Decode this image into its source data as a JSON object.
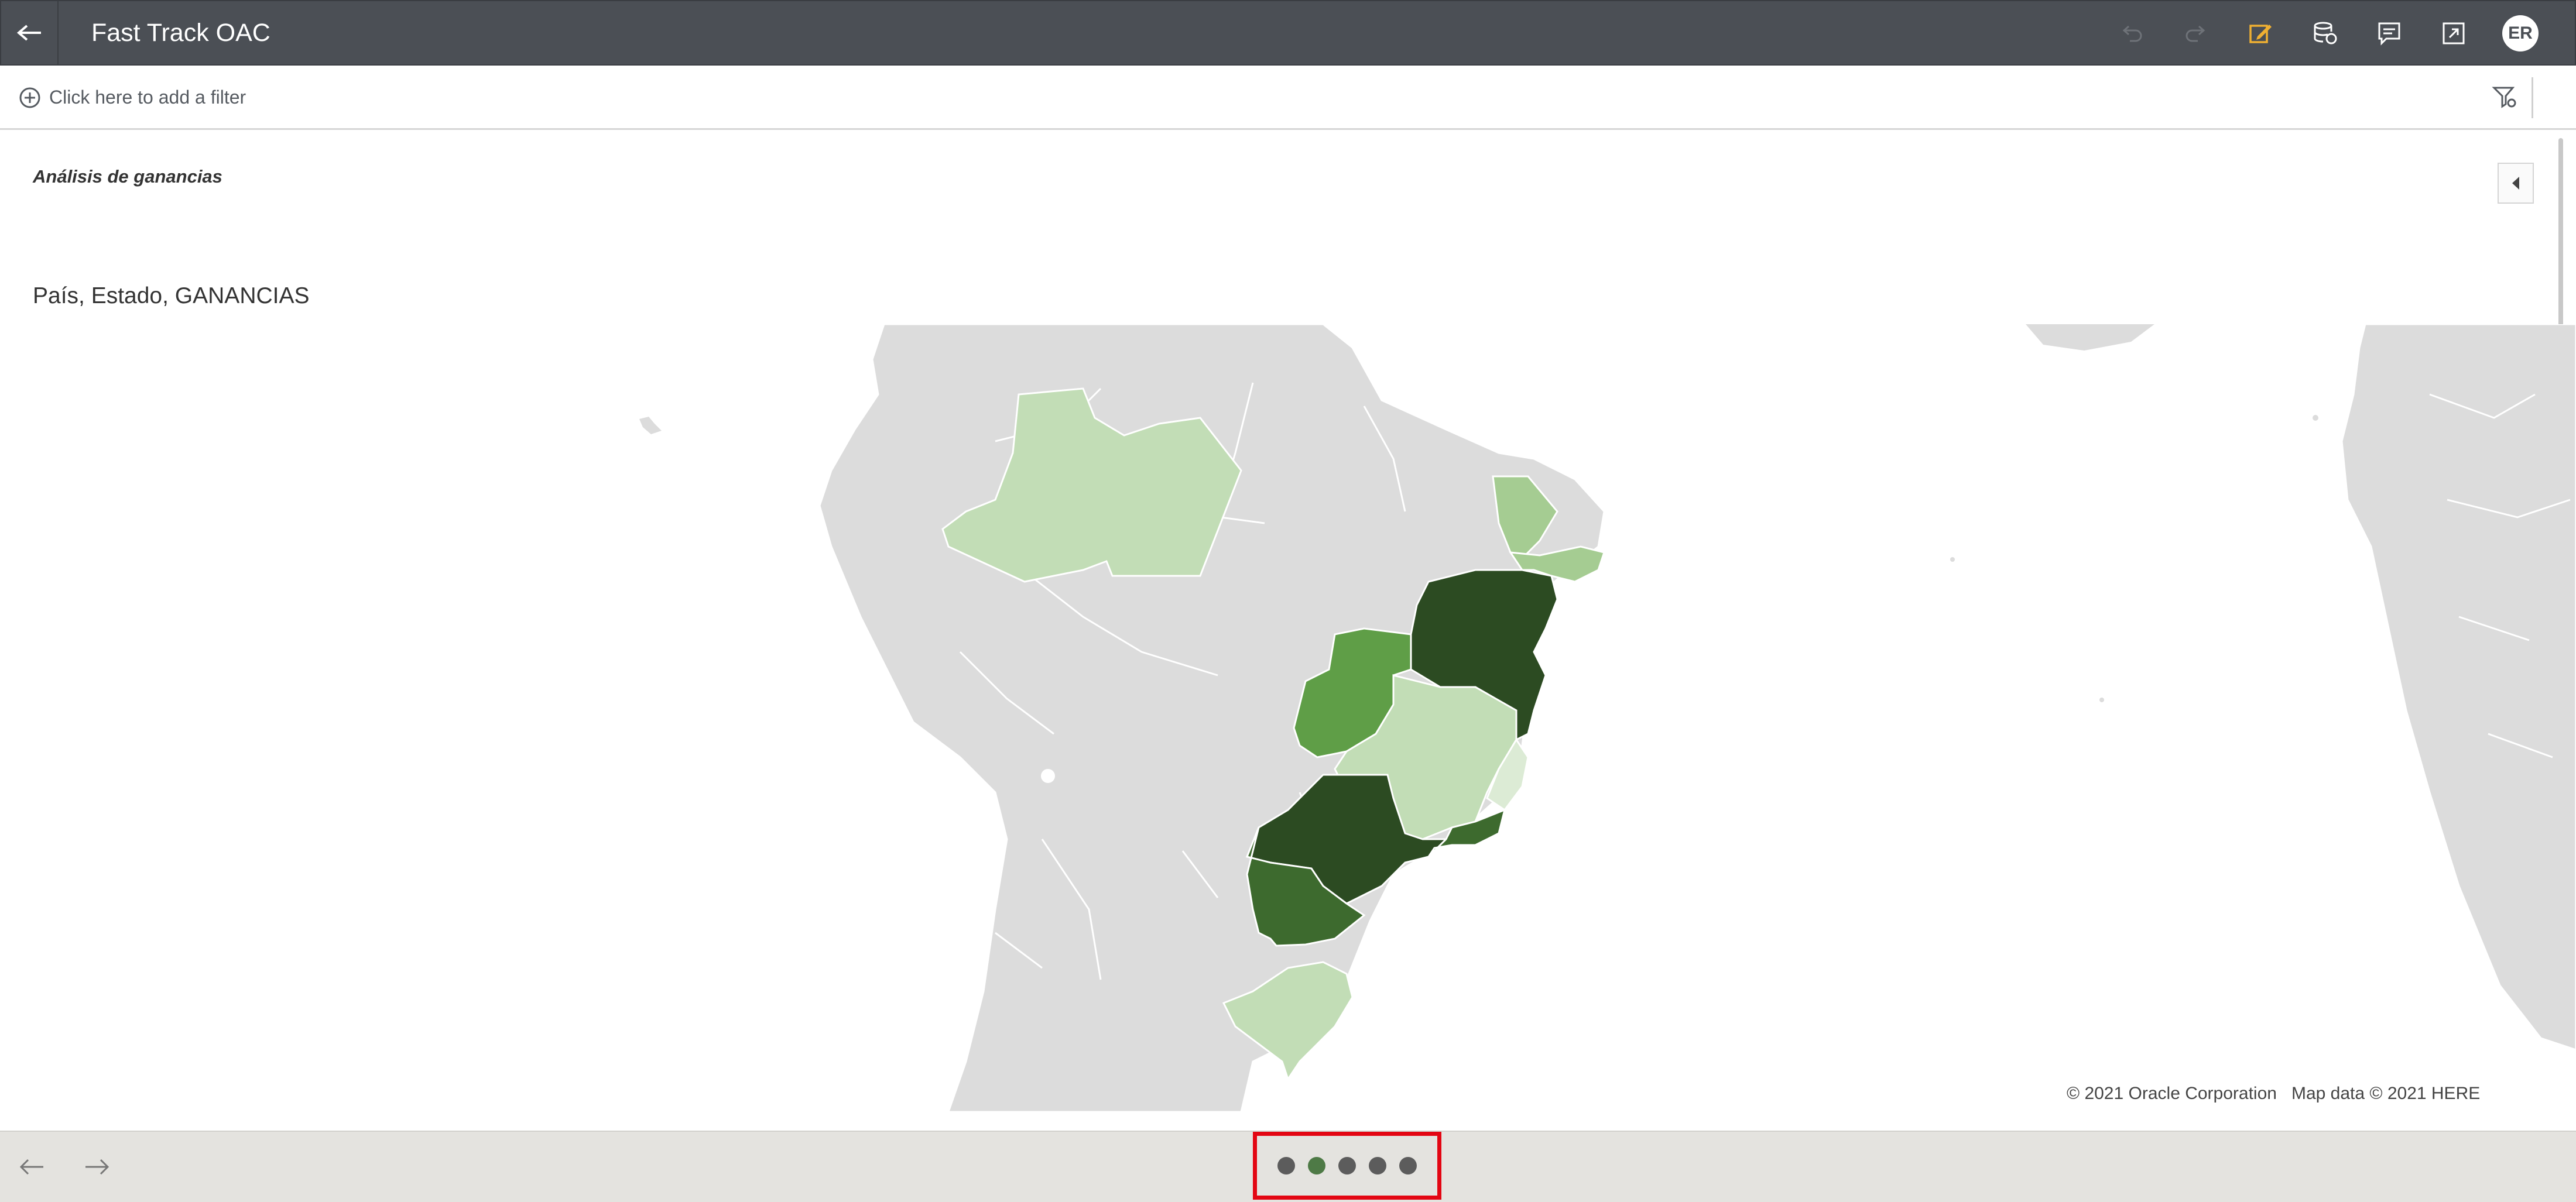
{
  "header": {
    "title": "Fast Track OAC",
    "avatar_initials": "ER",
    "icons": [
      "back-arrow-icon",
      "undo-icon",
      "redo-icon",
      "edit-icon",
      "data-refresh-icon",
      "comment-icon",
      "present-icon"
    ]
  },
  "filterbar": {
    "placeholder": "Click here to add a filter"
  },
  "canvas": {
    "title": "Análisis de ganancias",
    "visualization_title": "País, Estado, GANANCIAS",
    "attribution": "© 2021 Oracle Corporation   Map data © 2021 HERE"
  },
  "map_legend_colors": {
    "level_1": "#dcebd5",
    "level_2": "#c2ddb6",
    "level_3": "#a5cc92",
    "level_4": "#5f9e47",
    "level_5": "#3d6a2e",
    "level_6": "#2c4b22",
    "land": "#dcdcdc",
    "ocean": "#ffffff"
  },
  "highlighted_states": [
    {
      "id": "amazonas",
      "level": "level_2"
    },
    {
      "id": "ceara",
      "level": "level_3"
    },
    {
      "id": "pernambuco",
      "level": "level_3"
    },
    {
      "id": "bahia",
      "level": "level_6"
    },
    {
      "id": "goias",
      "level": "level_4"
    },
    {
      "id": "minas-gerais",
      "level": "level_2"
    },
    {
      "id": "espirito-santo",
      "level": "level_1"
    },
    {
      "id": "sao-paulo",
      "level": "level_6"
    },
    {
      "id": "rio-de-janeiro",
      "level": "level_5"
    },
    {
      "id": "parana",
      "level": "level_5"
    },
    {
      "id": "rio-grande-do-sul",
      "level": "level_2"
    }
  ],
  "footer": {
    "pages": 5,
    "active_page": 2
  }
}
